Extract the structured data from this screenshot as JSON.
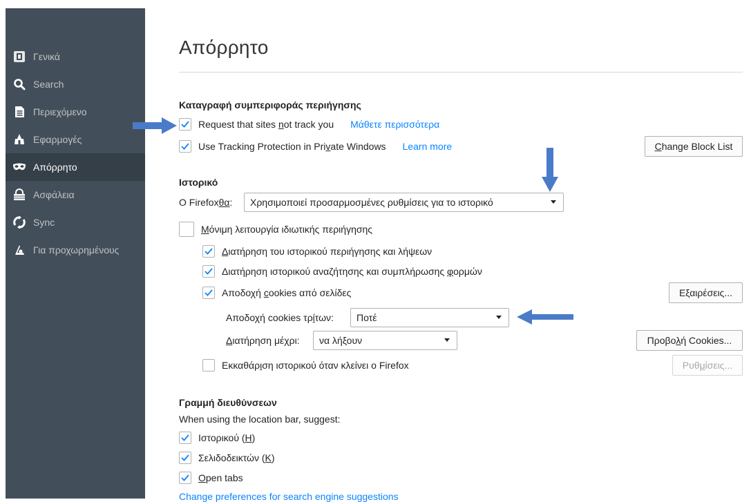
{
  "sidebar": {
    "items": [
      {
        "label": "Γενικά",
        "icon": "general-icon"
      },
      {
        "label": "Search",
        "icon": "search-icon"
      },
      {
        "label": "Περιεχόμενο",
        "icon": "content-icon"
      },
      {
        "label": "Εφαρμογές",
        "icon": "applications-icon"
      },
      {
        "label": "Απόρρητο",
        "icon": "privacy-mask-icon",
        "selected": true
      },
      {
        "label": "Ασφάλεια",
        "icon": "security-icon"
      },
      {
        "label": "Sync",
        "icon": "sync-icon"
      },
      {
        "label": "Για προχωρημένους",
        "icon": "advanced-icon"
      }
    ]
  },
  "page": {
    "title": "Απόρρητο"
  },
  "tracking": {
    "heading": "Καταγραφή συμπεριφοράς περιήγησης",
    "dnt_pre": "Request that sites ",
    "dnt_key": "n",
    "dnt_post": "ot track you",
    "dnt_checked": true,
    "dnt_link": "Μάθετε περισσότερα",
    "tp_pre": "Use Tracking Protection in Pri",
    "tp_key": "v",
    "tp_post": "ate Windows",
    "tp_checked": true,
    "tp_link": "Learn more",
    "block_list_key": "C",
    "block_list_rest": "hange Block List"
  },
  "history": {
    "heading": "Ιστορικό",
    "will_pre": "O Firefox ",
    "will_key": "θα",
    "will_post": ":",
    "mode_value": "Χρησιμοποιεί προσαρμοσμένες ρυθμίσεις για το ιστορικό",
    "private_key": "Μ",
    "private_rest": "όνιμη λειτουργία ιδιωτικής περιήγησης",
    "private_checked": false,
    "remember_browsing_key": "Δ",
    "remember_browsing_rest": "ιατήρηση του ιστορικού περιήγησης και λήψεων",
    "remember_browsing_checked": true,
    "remember_search_pre": "Διατήρηση ιστορικού αναζήτησης και συμπλήρωσης ",
    "remember_search_key": "φ",
    "remember_search_post": "ορμών",
    "remember_search_checked": true,
    "cookies_pre": "Αποδοχή ",
    "cookies_key": "c",
    "cookies_post": "ookies από σελίδες",
    "cookies_checked": true,
    "exceptions_button": "Εξαιρέσεις...",
    "third_party_pre": "Αποδοχή cookies τρ",
    "third_party_key": "ί",
    "third_party_post": "των:",
    "third_party_value": "Ποτέ",
    "keep_until_key": "Δ",
    "keep_until_rest": "ιατήρηση μέχρι:",
    "keep_until_value": "να λήξουν",
    "show_cookies_pre": "Προβο",
    "show_cookies_key": "λ",
    "show_cookies_post": "ή Cookies...",
    "clear_pre": "Εκκαθάρ",
    "clear_key": "ι",
    "clear_post": "ση ιστορικού όταν κλείνει ο Firefox",
    "clear_checked": false,
    "settings_pre": "Ρυθ",
    "settings_key": "μ",
    "settings_post": "ίσεις..."
  },
  "location_bar": {
    "heading": "Γραμμή διευθύνσεων",
    "suggest_label": "When using the location bar, suggest:",
    "history_pre": "Ιστορικού (",
    "history_key": "H",
    "history_post": ")",
    "history_checked": true,
    "bookmarks_pre": "Σελιδοδεικτών (",
    "bookmarks_key": "K",
    "bookmarks_post": ")",
    "bookmarks_checked": true,
    "tabs_key": "O",
    "tabs_rest": "pen tabs",
    "tabs_checked": true,
    "search_suggest_link": "Change preferences for search engine suggestions"
  },
  "colors": {
    "sidebar_bg": "#424f5a",
    "sidebar_selected": "#343f48",
    "link": "#0a84ff",
    "checkmark": "#0a84ff",
    "annotation_arrow": "#4a7bc8"
  }
}
